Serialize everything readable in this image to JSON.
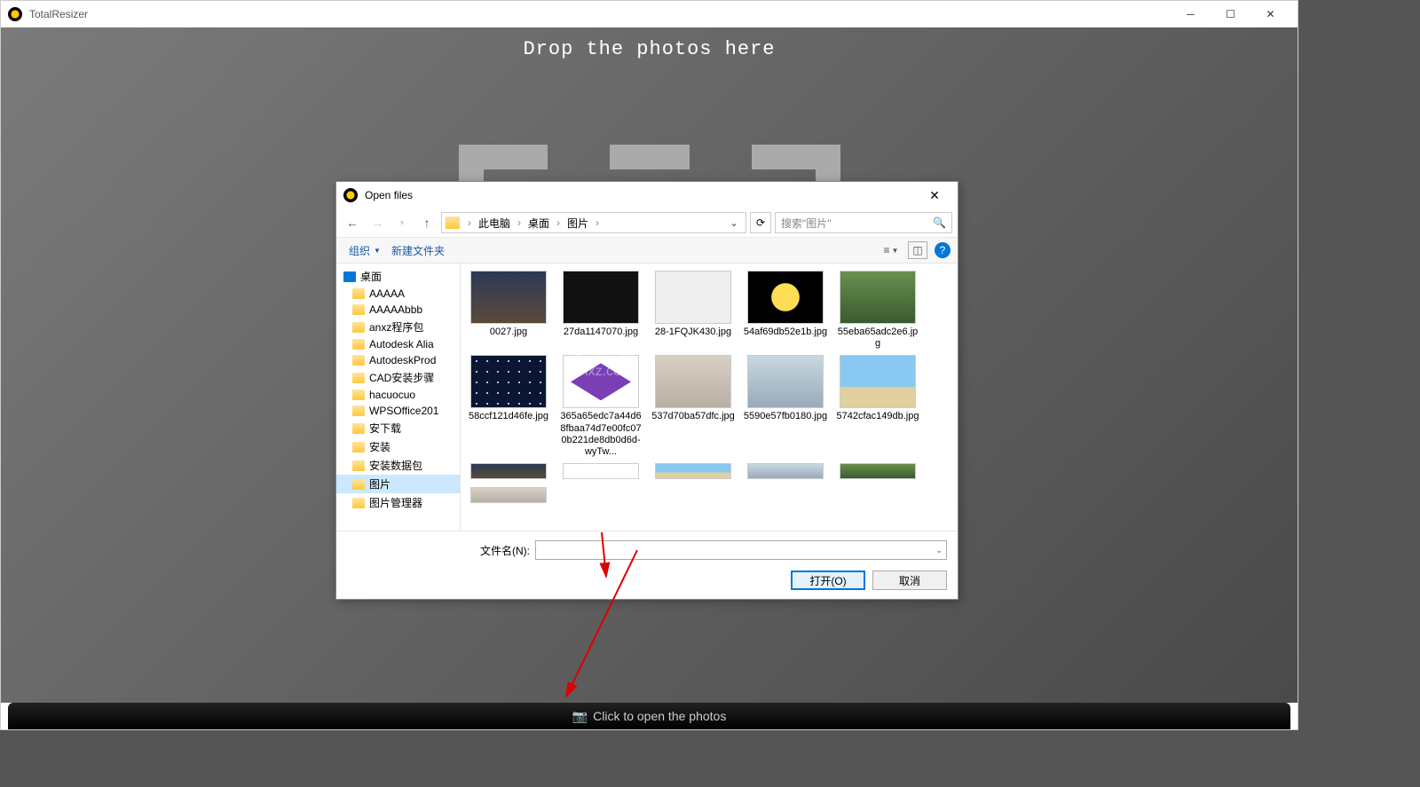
{
  "window": {
    "title": "TotalResizer",
    "drop_text": "Drop the photos here",
    "bottom_text": "Click to open the photos"
  },
  "dialog": {
    "title": "Open files",
    "breadcrumb": [
      "此电脑",
      "桌面",
      "图片"
    ],
    "search_placeholder": "搜索\"图片\"",
    "toolbar": {
      "organize": "组织",
      "new_folder": "新建文件夹"
    },
    "footer": {
      "filename_label": "文件名(N):",
      "open": "打开(O)",
      "cancel": "取消"
    },
    "tree": [
      {
        "label": "桌面",
        "root": true
      },
      {
        "label": "AAAAA"
      },
      {
        "label": "AAAAAbbb"
      },
      {
        "label": "anxz程序包"
      },
      {
        "label": "Autodesk Alia"
      },
      {
        "label": "AutodeskProd"
      },
      {
        "label": "CAD安装步骤"
      },
      {
        "label": "hacuocuo"
      },
      {
        "label": "WPSOffice201"
      },
      {
        "label": "安下载"
      },
      {
        "label": "安装"
      },
      {
        "label": "安装数据包"
      },
      {
        "label": "图片",
        "selected": true
      },
      {
        "label": "图片管理器"
      }
    ],
    "files": [
      {
        "name": "0027.jpg",
        "thumb": "t-moon"
      },
      {
        "name": "27da1147070.jpg",
        "thumb": "t-dark"
      },
      {
        "name": "28-1FQJK430.jpg",
        "thumb": "t-light"
      },
      {
        "name": "54af69db52e1b.jpg",
        "thumb": "t-skull"
      },
      {
        "name": "55eba65adc2e6.jpg",
        "thumb": "t-green"
      },
      {
        "name": "58ccf121d46fe.jpg",
        "thumb": "t-stars"
      },
      {
        "name": "365a65edc7a44d68fbaa74d7e00fc070b221de8db0d6d-wyTw...",
        "thumb": "t-purple"
      },
      {
        "name": "537d70ba57dfc.jpg",
        "thumb": "t-ppl"
      },
      {
        "name": "5590e57fb0180.jpg",
        "thumb": "t-ppl2"
      },
      {
        "name": "5742cfac149db.jpg",
        "thumb": "t-beach"
      }
    ],
    "files_partial": [
      {
        "thumb": "t-moon"
      },
      {
        "thumb": "t-purple"
      },
      {
        "thumb": "t-beach"
      },
      {
        "thumb": "t-ppl2"
      },
      {
        "thumb": "t-green"
      },
      {
        "thumb": "t-ppl"
      }
    ]
  },
  "watermark": {
    "top": "安下载",
    "bottom": "anxz.com"
  }
}
